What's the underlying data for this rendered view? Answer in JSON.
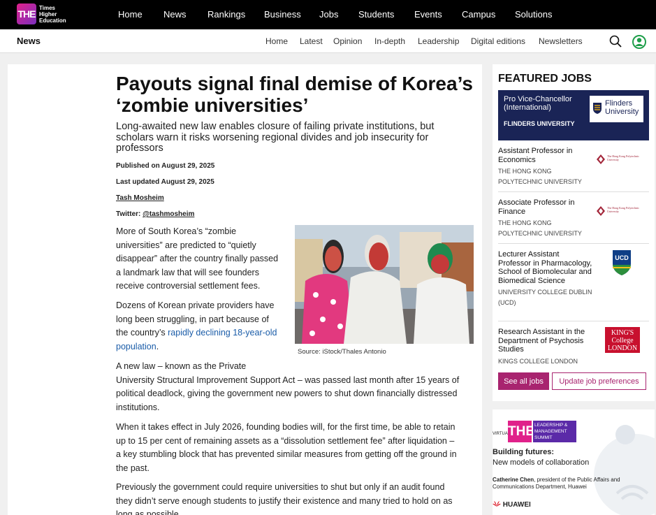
{
  "brand": {
    "mark": "THE",
    "name_lines": [
      "Times",
      "Higher",
      "Education"
    ]
  },
  "top_nav": [
    "Home",
    "News",
    "Rankings",
    "Business",
    "Jobs",
    "Students",
    "Events",
    "Campus",
    "Solutions"
  ],
  "section": {
    "title": "News",
    "nav": [
      "Home",
      "Latest",
      "Opinion",
      "In-depth",
      "Leadership",
      "Digital editions",
      "Newsletters"
    ]
  },
  "article": {
    "headline": "Payouts signal final demise of Korea’s ‘zombie universities’",
    "standfirst": "Long-awaited new law enables closure of failing private institutions, but scholars warn it risks worsening regional divides and job insecurity for professors",
    "published": "Published on August 29, 2025",
    "updated": "Last updated August 29, 2025",
    "author": "Tash Mosheim",
    "twitter_label": "Twitter: ",
    "twitter_handle": "@tashmosheim",
    "p1_lines": [
      "More of South Korea’s “zombie",
      "universities” are predicted to “quietly",
      "disappear” after the country finally passed",
      "a landmark law that will see founders",
      "receive controversial settlement fees."
    ],
    "p2_lines": [
      "Dozens of Korean private providers have",
      "long been struggling, in part because of",
      "the country’s "
    ],
    "p2_link_a": "rapidly declining 18-year-old",
    "p2_link_b": "population",
    "p2_end": ".",
    "p3_lines": [
      "A new law – known as the Private",
      "University Structural Improvement Support Act – was passed last month after 15 years of",
      "political deadlock, giving the government new powers to shut down financially distressed",
      "institutions."
    ],
    "p4_lines": [
      "When it takes effect in July 2026, founding bodies will, for the first time, be able to retain",
      "up to 15 per cent of remaining assets as a “dissolution settlement fee” after liquidation –",
      "a key stumbling block that has prevented similar measures from getting off the ground in",
      "the past."
    ],
    "p5_lines": [
      "Previously the government could require universities to shut but only if an audit found",
      "they didn’t serve enough students to justify their existence and many tried to hold on as",
      "long as possible."
    ],
    "image_caption": "Source: iStock/Thales Antonio"
  },
  "featured_jobs": {
    "heading": "FEATURED JOBS",
    "promo": {
      "title": "Pro Vice-Chancellor (International)",
      "org": "FLINDERS UNIVERSITY",
      "logo_text": [
        "Flinders",
        "University"
      ]
    },
    "jobs": [
      {
        "title": "Assistant Professor in Economics",
        "org": "The Hong Kong Polytechnic University",
        "logo": "The Hong Kong Polytechnic University"
      },
      {
        "title": "Associate Professor in Finance",
        "org": "The Hong Kong Polytechnic University",
        "logo": "The Hong Kong Polytechnic University"
      },
      {
        "title": "Lecturer Assistant Professor in Pharmacology, School of Biomolecular and Biomedical Science",
        "org": "University College Dublin (UCD)",
        "logo": "UCD"
      },
      {
        "title": "Research Assistant in the Department of Psychosis Studies",
        "org": "Kings College London",
        "logo": "KING'S College LONDON"
      }
    ],
    "see_all": "See all jobs",
    "update_prefs": "Update job preferences"
  },
  "ad": {
    "logo_left": "VIRTUAL",
    "logo_mark": "THE",
    "logo_right": [
      "LEADERSHIP &",
      "MANAGEMENT",
      "SUMMIT"
    ],
    "heading": "Building futures:",
    "subheading": "New models of collaboration",
    "speaker_name": "Catherine Chen",
    "speaker_role": ", president of the Public Affairs and Communications Department, Huawei",
    "sponsor": "HUAWEI"
  },
  "colors": {
    "brand_magenta": "#a8246f",
    "promo_navy": "#1a2456",
    "link_blue": "#1a5ca8"
  }
}
